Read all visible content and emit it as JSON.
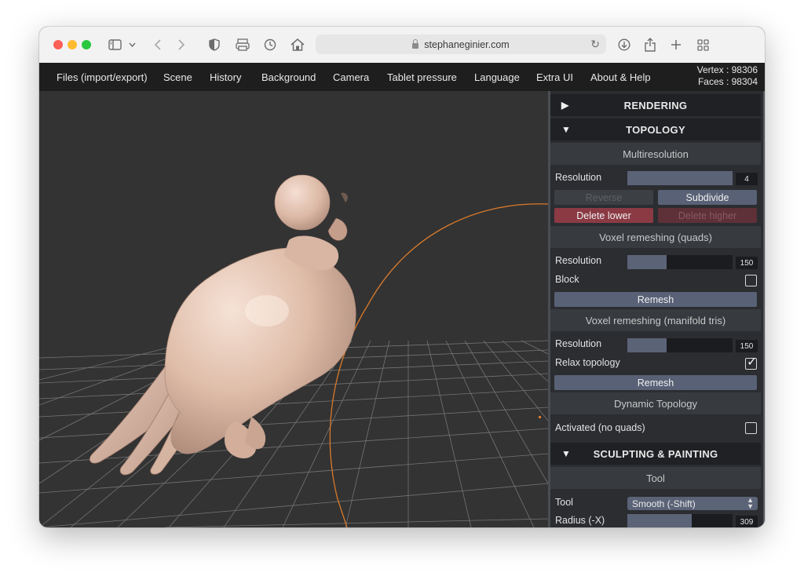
{
  "browser": {
    "url": "stephaneginier.com",
    "icons": [
      "sidebar-icon",
      "chevron-down-icon",
      "back-icon",
      "forward-icon",
      "shield-icon",
      "reader-icon",
      "history-icon",
      "home-icon",
      "reload-icon",
      "download-icon",
      "share-icon",
      "plus-icon",
      "tabs-grid-icon"
    ]
  },
  "menu": {
    "items": [
      "Files (import/export)",
      "Scene",
      "History",
      "Background",
      "Camera",
      "Tablet pressure",
      "Language",
      "Extra UI",
      "About & Help"
    ],
    "vertex": "Vertex : 98306",
    "faces": "Faces : 98304"
  },
  "panel": {
    "rendering": {
      "arrow": "▶",
      "title": "RENDERING"
    },
    "topology": {
      "arrow": "▼",
      "title": "TOPOLOGY"
    },
    "multires": {
      "title": "Multiresolution",
      "resolution_label": "Resolution",
      "resolution_value": "4",
      "resolution_fraction": 1.0,
      "reverse": "Reverse",
      "subdivide": "Subdivide",
      "delete_lower": "Delete lower",
      "delete_higher": "Delete higher"
    },
    "voxel_quads": {
      "title": "Voxel remeshing (quads)",
      "resolution_label": "Resolution",
      "resolution_value": "150",
      "resolution_fraction": 0.37,
      "block_label": "Block",
      "block_checked": false,
      "remesh": "Remesh"
    },
    "voxel_tris": {
      "title": "Voxel remeshing (manifold tris)",
      "resolution_label": "Resolution",
      "resolution_value": "150",
      "resolution_fraction": 0.37,
      "relax_label": "Relax topology",
      "relax_checked": true,
      "remesh": "Remesh"
    },
    "dynamic": {
      "title": "Dynamic Topology",
      "activated_label": "Activated (no quads)",
      "activated_checked": false
    },
    "sculpting": {
      "arrow": "▼",
      "title": "SCULPTING & PAINTING"
    },
    "tool": {
      "title": "Tool",
      "tool_label": "Tool",
      "tool_value": "Smooth (-Shift)",
      "radius_label": "Radius (-X)",
      "radius_value": "309",
      "radius_fraction": 0.61
    }
  },
  "colors": {
    "viewport_bg": "#333333",
    "mesh": "#e0bfae",
    "grid": "#8a8a8a",
    "gizmo": "#d97a2b",
    "slider_fill": "#5b6377",
    "danger": "#8b3a44"
  }
}
